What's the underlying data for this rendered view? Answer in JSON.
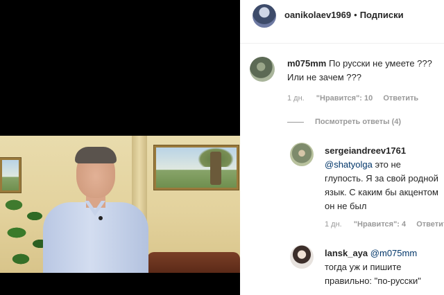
{
  "post": {
    "owner_username": "oanikolaev1969",
    "separator": "•",
    "follow_label": "Подписки"
  },
  "comments": [
    {
      "username": "m075mm",
      "text": "По русски не умеете ??? Или не зачем ???",
      "time": "1 дн.",
      "likes": "\"Нравится\": 10",
      "reply_label": "Ответить",
      "view_replies": "Посмотреть ответы (4)"
    }
  ],
  "replies": [
    {
      "username": "sergeiandreev1761",
      "mention": "@shatyolga",
      "text": "это не глупость. Я за свой родной язык. С каким бы акцентом он не был",
      "time": "1 дн.",
      "likes": "\"Нравится\": 4",
      "reply_label": "Ответить"
    },
    {
      "username": "lansk_aya",
      "mention": "@m075mm",
      "text": "тогда уж и пишите правильно: \"по-русски\""
    }
  ]
}
